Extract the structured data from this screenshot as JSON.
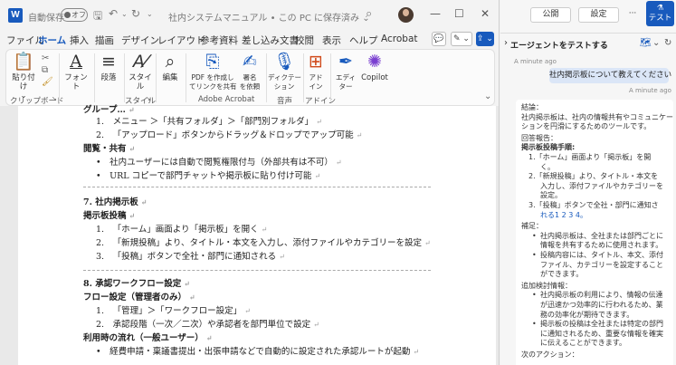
{
  "titlebar": {
    "app_icon": "W",
    "autosave_label": "自動保存",
    "autosave_state": "オフ",
    "doc_title": "社内システムマニュアル • この PC に保存済み ⌄",
    "icons": [
      "save-icon",
      "undo-icon",
      "redo-icon",
      "search-icon"
    ],
    "window_controls": [
      "—",
      "☐",
      "✕"
    ]
  },
  "menu": {
    "tabs": [
      "ファイル",
      "ホーム",
      "挿入",
      "描画",
      "デザイン",
      "レイアウト",
      "参考資料",
      "差し込み文書",
      "校閲",
      "表示",
      "ヘルプ",
      "Acrobat"
    ],
    "active": "ホーム",
    "right_buttons": [
      "💬",
      "✎ ⌄",
      "⇪ ⌄"
    ]
  },
  "ribbon": {
    "buttons": {
      "paste": "貼り付け",
      "font": "フォント",
      "paragraph": "段落",
      "style": "スタイル",
      "edit": "編集",
      "pdf_share": "PDF を作成し\nてリンクを共有",
      "sign": "署名\nを依頼",
      "dictate": "ディクテー\nション",
      "addin": "アド\nイン",
      "editor": "エディ\nター",
      "copilot": "Copilot"
    },
    "groups": {
      "clipboard": "クリップボード",
      "style": "スタイル",
      "acrobat": "Adobe Acrobat",
      "voice": "音声",
      "addin": "アドイン"
    },
    "paste_dropdown": "⌄",
    "clipboard_expand": "↘",
    "style_expand": "↘",
    "collapse": "⌄"
  },
  "document": {
    "lines": [
      {
        "t": "グループ…",
        "cls": "b"
      },
      {
        "t": "1. メニュー ＞「共有フォルダ」＞「部門別フォルダ」",
        "cls": ""
      },
      {
        "t": "2. 「アップロード」ボタンからドラッグ＆ドロップでアップ可能",
        "cls": ""
      },
      {
        "t": "閲覧・共有",
        "cls": "b"
      },
      {
        "t": "• 社内ユーザーには自動で閲覧権限付与（外部共有は不可）",
        "cls": ""
      },
      {
        "t": "• URL コピーで部門チャットや掲示板に貼り付け可能",
        "cls": ""
      },
      {
        "t": "7. 社内掲示板",
        "cls": "b"
      },
      {
        "t": "掲示板投稿",
        "cls": "b"
      },
      {
        "t": "1. 「ホーム」画面より「掲示板」を開く",
        "cls": ""
      },
      {
        "t": "2. 「新規投稿」より、タイトル・本文を入力し、添付ファイルやカテゴリーを設定",
        "cls": ""
      },
      {
        "t": "3. 「投稿」ボタンで全社・部門に通知される",
        "cls": ""
      },
      {
        "t": "8. 承認ワークフロー設定",
        "cls": "b"
      },
      {
        "t": "フロー設定（管理者のみ）",
        "cls": "b"
      },
      {
        "t": "1. 「管理」＞「ワークフロー設定」",
        "cls": ""
      },
      {
        "t": "2. 承認段階（一次／二次）や承認者を部門単位で設定",
        "cls": ""
      },
      {
        "t": "利用時の流れ（一般ユーザー）",
        "cls": "b"
      },
      {
        "t": "• 経費申請・稟議書提出・出張申請などで自動的に設定された承認ルートが起動",
        "cls": ""
      }
    ],
    "para_mark": "↵"
  },
  "copilot": {
    "publish": "公開",
    "settings": "設定",
    "more": "···",
    "test_label": "テスト",
    "header_title": "エージェントをテストする",
    "header_chevron": "›",
    "header_icons": [
      "🗺",
      "⌄",
      "↻"
    ],
    "time1": "A minute ago",
    "user_message": "社内掲示板について教えてください",
    "time2": "A minute ago",
    "answer": [
      {
        "t": "結論：",
        "cls": ""
      },
      {
        "t": "社内掲示板は、社内の情報共有やコミュニケー",
        "cls": ""
      },
      {
        "t": "ションを円滑にするためのツールです。",
        "cls": ""
      },
      {
        "t": "回答報告：",
        "cls": ""
      },
      {
        "t": "掲示板投稿手順:",
        "cls": "b"
      },
      {
        "t": "1.「ホーム」画面より「掲示板」を開",
        "cls": "",
        "indent": 1
      },
      {
        "t": "く。",
        "cls": "",
        "indent": 2
      },
      {
        "t": "2.「新規投稿」より、タイトル・本文を",
        "cls": "",
        "indent": 1
      },
      {
        "t": "入力し、添付ファイルやカテゴリーを",
        "cls": "",
        "indent": 2
      },
      {
        "t": "設定。",
        "cls": "",
        "indent": 2
      },
      {
        "t": "3.「投稿」ボタンで全社・部門に通知さ",
        "cls": "",
        "indent": 1
      },
      {
        "t": "れる1 2 3 4。",
        "cls": "cite",
        "indent": 2
      },
      {
        "t": "補足：",
        "cls": ""
      },
      {
        "t": "社内掲示板は、全社または部門ごとに",
        "cls": "bullet",
        "indent": 2
      },
      {
        "t": "情報を共有するために使用されます。",
        "cls": "",
        "indent": 2
      },
      {
        "t": "投稿内容には、タイトル、本文、添付",
        "cls": "bullet",
        "indent": 2
      },
      {
        "t": "ファイル、カテゴリーを設定すること",
        "cls": "",
        "indent": 2
      },
      {
        "t": "ができます。",
        "cls": "",
        "indent": 2
      },
      {
        "t": "追加検討情報：",
        "cls": ""
      },
      {
        "t": "社内掲示板の利用により、情報の伝達",
        "cls": "bullet",
        "indent": 2
      },
      {
        "t": "が迅速かつ効率的に行われるため、業",
        "cls": "",
        "indent": 2
      },
      {
        "t": "務の効率化が期待できます。",
        "cls": "",
        "indent": 2
      },
      {
        "t": "掲示板の投稿は全社または特定の部門",
        "cls": "bullet",
        "indent": 2
      },
      {
        "t": "に通知されるため、重要な情報を確実",
        "cls": "",
        "indent": 2
      },
      {
        "t": "に伝えることができます。",
        "cls": "",
        "indent": 2
      },
      {
        "t": "次のアクション：",
        "cls": ""
      }
    ]
  }
}
